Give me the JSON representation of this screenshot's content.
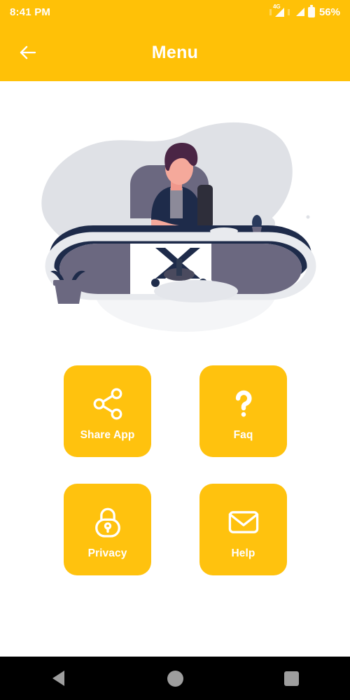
{
  "status_bar": {
    "time": "8:41 PM",
    "network_type": "4G",
    "battery_percent": "56%",
    "icons": [
      "signal-4g-icon",
      "signal-icon",
      "battery-icon"
    ]
  },
  "app_bar": {
    "title": "Menu",
    "back_icon": "arrow-left-icon",
    "background_color": "#FFC107",
    "text_color": "#FFFFFF"
  },
  "illustration": {
    "name": "person-at-desk-illustration",
    "alt": "Person sitting at an oval office desk with chair, cup and plant",
    "colors": {
      "blob": "#DFE1E6",
      "desk_top": "#1E2B4A",
      "desk_panel": "#6B6880",
      "desk_edge": "#E8EAEE",
      "skin": "#F5A99B",
      "hair": "#4A2545",
      "shirt": "#8C8A99"
    }
  },
  "menu": {
    "rows": [
      [
        {
          "label": "Share App",
          "icon": "share-icon"
        },
        {
          "label": "Faq",
          "icon": "question-mark-icon"
        }
      ],
      [
        {
          "label": "Privacy",
          "icon": "lock-icon"
        },
        {
          "label": "Help",
          "icon": "envelope-icon"
        }
      ]
    ],
    "card_color": "#FFC20E",
    "label_color": "#FFFFFF"
  },
  "nav_bar": {
    "buttons": [
      {
        "name": "back",
        "icon": "triangle-back-icon"
      },
      {
        "name": "home",
        "icon": "circle-home-icon"
      },
      {
        "name": "recents",
        "icon": "square-recents-icon"
      }
    ],
    "background_color": "#000000",
    "icon_color": "#9E9E9E"
  }
}
